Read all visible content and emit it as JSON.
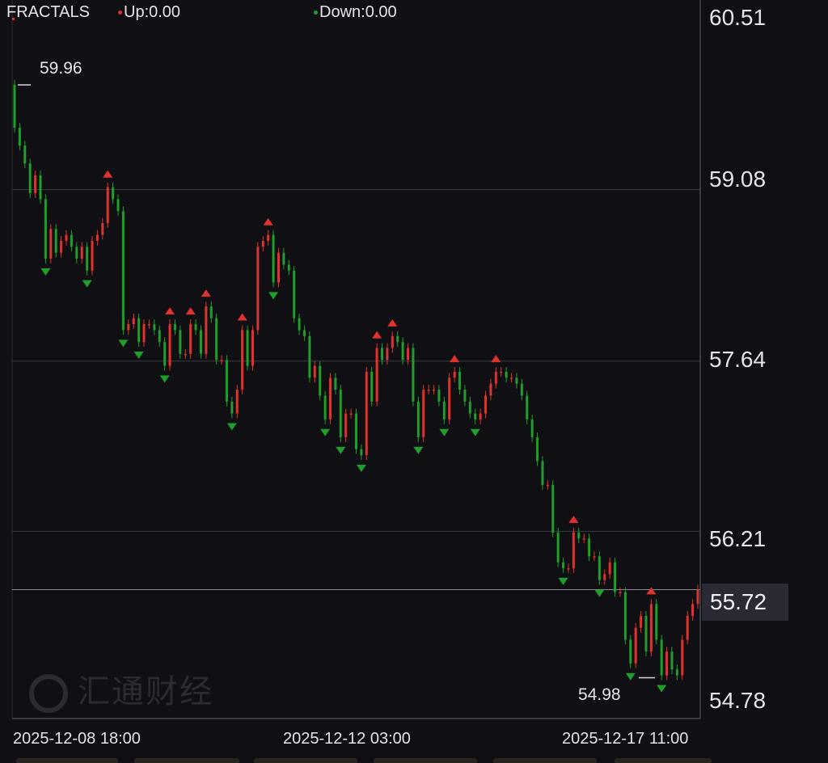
{
  "indicator": {
    "name": "FRACTALS",
    "up_label": "Up:0.00",
    "down_label": "Down:0.00",
    "up_color": "#e0322c",
    "down_color": "#1f9e2a"
  },
  "current_price": "55.72",
  "annotations": {
    "high": "59.96",
    "low": "54.98"
  },
  "watermark": "汇通财经",
  "chart_data": {
    "type": "candlestick",
    "y_axis": {
      "ticks": [
        "60.51",
        "59.08",
        "57.64",
        "56.21",
        "54.78"
      ],
      "range": [
        54.78,
        60.51
      ]
    },
    "x_axis": {
      "tick_labels": [
        "2025-12-08 18:00",
        "2025-12-12 03:00",
        "2025-12-17 11:00"
      ]
    },
    "grid": true,
    "current_price": 55.72,
    "high": 59.96,
    "low": 54.98,
    "colors": {
      "up": "#e0322c",
      "down": "#1f9e2a"
    },
    "close": [
      59.6,
      59.45,
      59.3,
      59.05,
      59.2,
      59.0,
      58.5,
      58.75,
      58.55,
      58.65,
      58.7,
      58.6,
      58.5,
      58.6,
      58.4,
      58.65,
      58.7,
      58.8,
      59.1,
      59.0,
      58.9,
      57.9,
      57.95,
      58.0,
      57.8,
      57.95,
      57.95,
      57.9,
      57.8,
      57.6,
      57.95,
      57.9,
      57.7,
      57.7,
      57.95,
      57.9,
      57.7,
      58.1,
      58.0,
      57.65,
      57.65,
      57.3,
      57.2,
      57.4,
      57.9,
      57.6,
      57.9,
      58.6,
      58.65,
      58.7,
      58.3,
      58.55,
      58.45,
      58.4,
      58.0,
      57.9,
      57.85,
      57.5,
      57.6,
      57.35,
      57.15,
      57.5,
      57.4,
      57.0,
      57.2,
      57.2,
      56.9,
      56.85,
      57.55,
      57.3,
      57.75,
      57.65,
      57.75,
      57.85,
      57.8,
      57.65,
      57.75,
      57.3,
      57.0,
      57.4,
      57.4,
      57.4,
      57.3,
      57.15,
      57.5,
      57.55,
      57.4,
      57.3,
      57.2,
      57.15,
      57.2,
      57.35,
      57.45,
      57.55,
      57.55,
      57.5,
      57.5,
      57.45,
      57.35,
      57.15,
      57.0,
      56.8,
      56.6,
      56.6,
      56.2,
      55.95,
      55.9,
      55.9,
      56.2,
      56.15,
      56.15,
      56.0,
      56.0,
      55.8,
      55.85,
      55.95,
      55.7,
      55.7,
      55.3,
      55.1,
      55.4,
      55.5,
      55.2,
      55.6,
      55.3,
      55.0,
      55.2,
      55.05,
      55.0,
      55.3,
      55.5,
      55.6,
      55.72
    ]
  }
}
